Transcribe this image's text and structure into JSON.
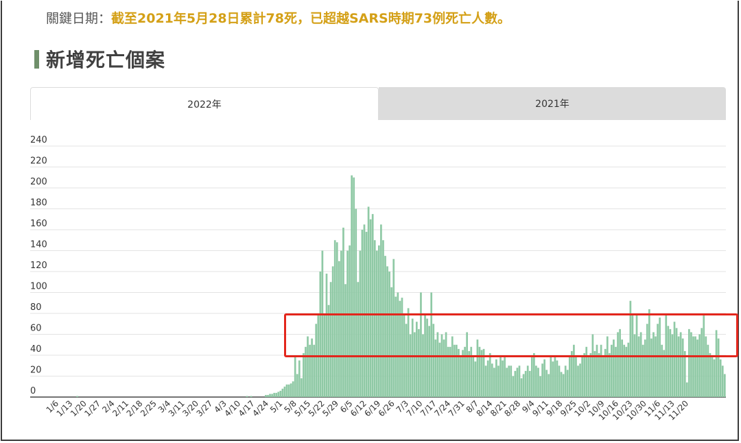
{
  "key_date": {
    "label": "關鍵日期：",
    "text": "截至2021年5月28日累計78死，已超越SARS時期73例死亡人數。"
  },
  "section_title": "新增死亡個案",
  "tabs": [
    {
      "label": "2022年",
      "active": true
    },
    {
      "label": "2021年",
      "active": false
    }
  ],
  "colors": {
    "bar": "#8fc9a5",
    "highlight": "#e3261c",
    "accent": "#d4a017",
    "title_bar": "#6f8f6a"
  },
  "chart_data": {
    "type": "bar",
    "title": "",
    "xlabel": "",
    "ylabel": "",
    "ylim": [
      0,
      240
    ],
    "yticks": [
      0,
      20,
      40,
      60,
      80,
      100,
      120,
      140,
      160,
      180,
      200,
      220,
      240
    ],
    "grid": true,
    "x_tick_labels": [
      "1/6",
      "1/13",
      "1/20",
      "1/27",
      "2/4",
      "2/11",
      "2/18",
      "2/25",
      "3/4",
      "3/11",
      "3/20",
      "3/27",
      "4/3",
      "4/10",
      "4/17",
      "4/24",
      "5/1",
      "5/8",
      "5/15",
      "5/22",
      "5/29",
      "6/5",
      "6/12",
      "6/19",
      "6/26",
      "7/3",
      "7/10",
      "7/17",
      "7/24",
      "7/31",
      "8/7",
      "8/14",
      "8/21",
      "8/28",
      "9/4",
      "9/11",
      "9/18",
      "9/25",
      "10/2",
      "10/9",
      "10/16",
      "10/23",
      "10/30",
      "11/6",
      "11/13",
      "11/20"
    ],
    "values": [
      0,
      0,
      0,
      0,
      0,
      0,
      0,
      0,
      0,
      0,
      0,
      0,
      0,
      0,
      0,
      0,
      0,
      0,
      0,
      0,
      0,
      0,
      1,
      0,
      0,
      0,
      0,
      0,
      0,
      0,
      0,
      0,
      0,
      0,
      0,
      0,
      0,
      0,
      0,
      0,
      0,
      0,
      0,
      0,
      0,
      0,
      0,
      0,
      0,
      0,
      0,
      0,
      0,
      0,
      0,
      0,
      0,
      0,
      0,
      0,
      0,
      0,
      0,
      0,
      0,
      0,
      0,
      0,
      0,
      0,
      0,
      0,
      0,
      0,
      0,
      0,
      0,
      0,
      0,
      0,
      0,
      0,
      0,
      0,
      0,
      0,
      0,
      0,
      0,
      0,
      0,
      0,
      0,
      0,
      0,
      0,
      0,
      0,
      0,
      0,
      0,
      0,
      0,
      1,
      0,
      1,
      0,
      0,
      0,
      0,
      0,
      0,
      2,
      2,
      3,
      3,
      4,
      4,
      5,
      6,
      8,
      10,
      12,
      12,
      13,
      15,
      40,
      22,
      35,
      18,
      42,
      48,
      58,
      50,
      56,
      50,
      70,
      78,
      120,
      140,
      80,
      118,
      88,
      110,
      125,
      150,
      148,
      130,
      140,
      162,
      108,
      140,
      145,
      212,
      210,
      180,
      110,
      140,
      160,
      165,
      158,
      182,
      170,
      175,
      150,
      140,
      145,
      165,
      150,
      135,
      125,
      120,
      105,
      132,
      96,
      100,
      92,
      95,
      80,
      70,
      85,
      60,
      75,
      62,
      72,
      65,
      100,
      60,
      80,
      75,
      68,
      100,
      70,
      55,
      62,
      52,
      60,
      55,
      62,
      48,
      48,
      58,
      50,
      50,
      46,
      40,
      45,
      48,
      62,
      44,
      48,
      38,
      34,
      55,
      48,
      45,
      46,
      30,
      35,
      42,
      32,
      28,
      36,
      30,
      40,
      35,
      38,
      28,
      30,
      30,
      20,
      25,
      28,
      30,
      18,
      22,
      25,
      30,
      25,
      38,
      42,
      30,
      28,
      20,
      32,
      36,
      26,
      22,
      40,
      34,
      38,
      35,
      30,
      24,
      22,
      30,
      26,
      40,
      44,
      50,
      38,
      30,
      32,
      40,
      42,
      48,
      38,
      42,
      60,
      44,
      50,
      42,
      50,
      38,
      46,
      58,
      42,
      50,
      55,
      48,
      62,
      65,
      55,
      50,
      48,
      52,
      92,
      78,
      60,
      80,
      58,
      62,
      50,
      55,
      70,
      84,
      56,
      62,
      58,
      70,
      76,
      50,
      45,
      80,
      68,
      65,
      60,
      72,
      66,
      58,
      62,
      56,
      44,
      14,
      65,
      62,
      58,
      58,
      55,
      60,
      66,
      78,
      58,
      50,
      42,
      38,
      36,
      64,
      56,
      36,
      30,
      22
    ]
  }
}
